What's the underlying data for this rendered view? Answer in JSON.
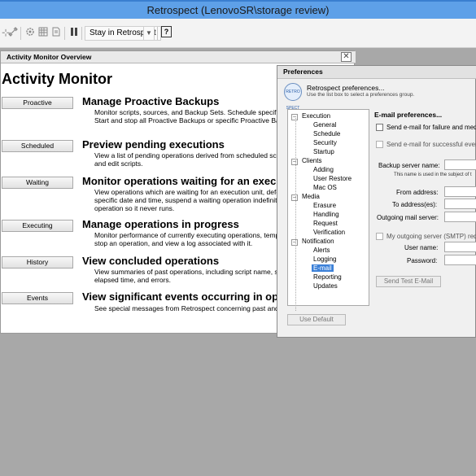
{
  "window": {
    "title": "Retrospect (LenovoSR\\storage review)"
  },
  "toolbar": {
    "icons": [
      "link-icon",
      "gear-icon",
      "grid-icon",
      "document-icon",
      "pause-icon"
    ],
    "stay_label": "Stay in Retrospect",
    "help_label": "?"
  },
  "activity_monitor": {
    "header": "Activity Monitor Overview",
    "title": "Activity Monitor",
    "sections": [
      {
        "button": "Proactive",
        "heading": "Manage Proactive Backups",
        "desc": "Monitor scripts, sources, and Backup Sets. Schedule specific backups of sources. Start and stop all Proactive Backups or specific Proactive Backup operations."
      },
      {
        "button": "Scheduled",
        "heading": "Preview pending executions",
        "desc": "View a list of pending operations derived from scheduled scripts, pending operations, and edit scripts."
      },
      {
        "button": "Waiting",
        "heading": "Monitor operations waiting for an execution unit",
        "desc": "View operations which are waiting for an execution unit, defer an operation until a specific date and time, suspend a waiting operation indefinitely, or remove a waiting operation so it never runs."
      },
      {
        "button": "Executing",
        "heading": "Manage operations in progress",
        "desc": "Monitor performance of currently executing operations, temporarily or permanently stop an operation, and view a log associated with it."
      },
      {
        "button": "History",
        "heading": "View concluded operations",
        "desc": "View summaries of past operations, including script name, start time, throughput, elapsed time, and errors."
      },
      {
        "button": "Events",
        "heading": "View significant events occurring in operations",
        "desc": "See special messages from Retrospect concerning past and present operations."
      }
    ]
  },
  "preferences": {
    "title": "Preferences",
    "logo_text": "RETRO SPECT",
    "header": "Retrospect preferences...",
    "subheader": "Use the list box to select a preferences group.",
    "tree": {
      "execution": "Execution",
      "general": "General",
      "schedule": "Schedule",
      "security": "Security",
      "startup": "Startup",
      "clients": "Clients",
      "adding": "Adding",
      "user_restore": "User Restore",
      "mac_os": "Mac OS",
      "media": "Media",
      "erasure": "Erasure",
      "handling": "Handling",
      "request": "Request",
      "verification": "Verification",
      "notification": "Notification",
      "alerts": "Alerts",
      "logging": "Logging",
      "email": "E-mail",
      "reporting": "Reporting",
      "updates": "Updates"
    },
    "email": {
      "section_title": "E-mail preferences...",
      "send_failure": "Send e-mail for failure and media r",
      "send_success": "Send e-mail for successful events",
      "backup_server_label": "Backup server name:",
      "note": "This name is used in the subject of t",
      "from_label": "From address:",
      "to_label": "To address(es):",
      "mail_server_label": "Outgoing mail server:",
      "smtp_auth_label": "My outgoing server (SMTP) requir",
      "username_label": "User name:",
      "password_label": "Password:",
      "send_test": "Send Test E-Mail",
      "use_default": "Use Default"
    }
  }
}
